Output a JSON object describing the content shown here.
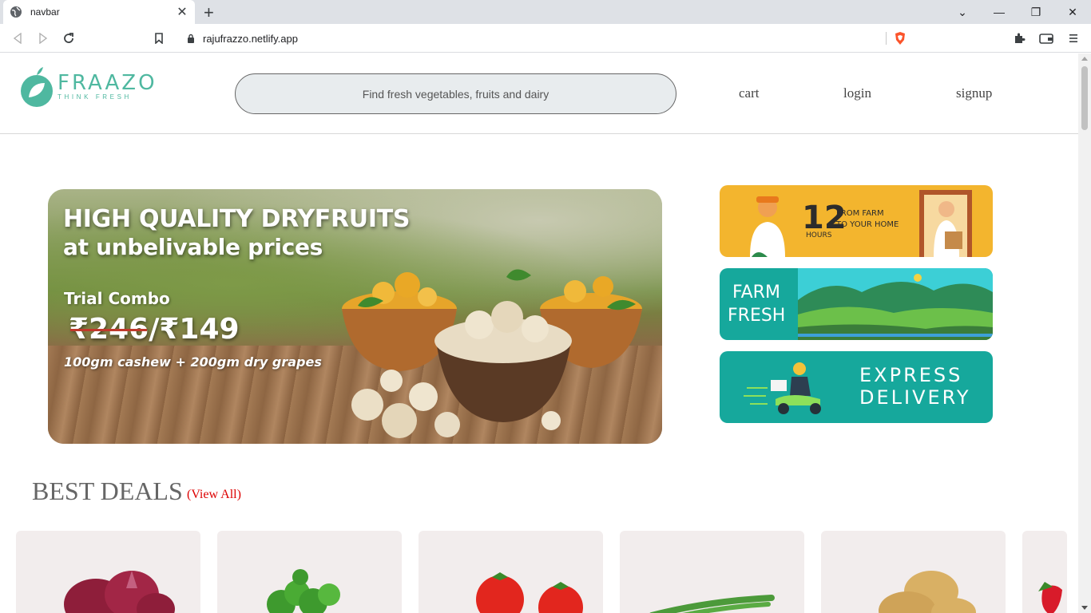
{
  "browser": {
    "tab_title": "navbar",
    "url": "rajufrazzo.netlify.app"
  },
  "site": {
    "logo_name": "FRAAZO",
    "logo_tagline": "THINK FRESH",
    "search_placeholder": "Find fresh vegetables, fruits and dairy",
    "nav": {
      "cart": "cart",
      "login": "login",
      "signup": "signup"
    }
  },
  "hero": {
    "headline": "HIGH QUALITY DRYFRUITS",
    "subheadline": "at unbelivable prices",
    "combo_label": "Trial Combo",
    "old_price": "₹246",
    "price_separator": "/",
    "new_price": "₹149",
    "description": "100gm cashew + 200gm dry grapes"
  },
  "promos": {
    "delivery_hours_number": "12",
    "delivery_hours_unit": "HOURS",
    "delivery_line1": "FROM FARM",
    "delivery_line2": "TO YOUR HOME",
    "farm_fresh_line1": "FARM",
    "farm_fresh_line2": "FRESH",
    "express_line1": "EXPRESS",
    "express_line2": "DELIVERY"
  },
  "deals": {
    "title": "BEST DEALS",
    "view_all": "(View All)",
    "products": [
      "onion",
      "coriander",
      "tomato",
      "beans",
      "potato",
      "strawberry"
    ]
  },
  "colors": {
    "brand": "#4fb8a0",
    "promo_yellow": "#f3b52e",
    "promo_teal": "#16a89c",
    "view_all_red": "#dd0000"
  }
}
